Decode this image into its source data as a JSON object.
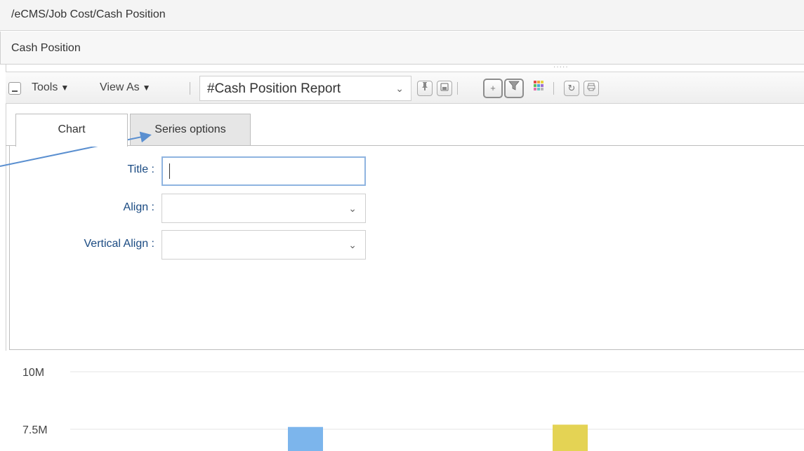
{
  "breadcrumb": "/eCMS/Job Cost/Cash Position",
  "panel": {
    "title": "Cash Position"
  },
  "toolbar": {
    "tools_label": "Tools",
    "view_as_label": "View As",
    "report_value": "#Cash Position Report"
  },
  "tabs": [
    {
      "label": "Chart",
      "active": true
    },
    {
      "label": "Series options",
      "active": false
    }
  ],
  "form": {
    "title_label": "Title :",
    "title_value": "",
    "align_label": "Align :",
    "align_value": "",
    "valign_label": "Vertical Align :",
    "valign_value": ""
  },
  "chart_data": {
    "type": "bar",
    "title": "",
    "xlabel": "",
    "ylabel": "",
    "y_ticks_visible": [
      "10M",
      "7.5M"
    ],
    "y_tick_values": [
      10000000,
      7500000
    ],
    "ylim_visible": [
      7000000,
      10500000
    ],
    "grid": true,
    "series": [
      {
        "values": [
          7600000
        ],
        "color": "#7cb5ec"
      },
      {
        "values": [
          7700000
        ],
        "color": "#e4d354"
      }
    ]
  },
  "icons": {
    "collapse": "minus-square-icon",
    "pin": "pin-icon",
    "save": "save-icon",
    "add": "plus-icon",
    "filter": "filter-icon",
    "color_grid": "color-grid-icon",
    "refresh": "refresh-icon",
    "print": "print-icon"
  },
  "colors": {
    "annotation_arrow": "#5a8fd0",
    "label_blue": "#1a4a82"
  }
}
